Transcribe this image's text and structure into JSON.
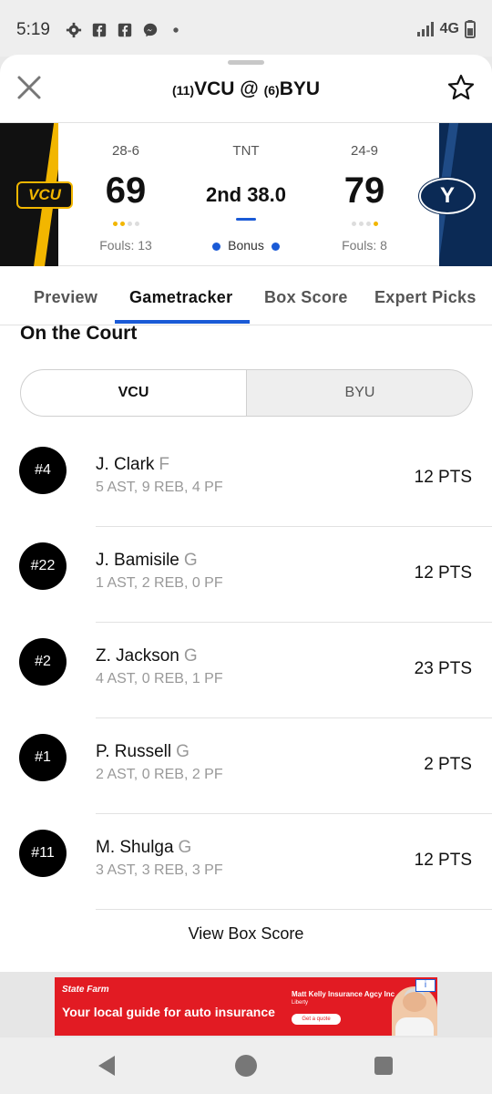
{
  "status_bar": {
    "time": "5:19",
    "network": "4G",
    "icons": [
      "gear-icon",
      "facebook-icon",
      "facebook-icon",
      "messenger-icon",
      "dot-icon",
      "signal-icon",
      "battery-icon"
    ]
  },
  "header": {
    "away_rank": "(11)",
    "away_name": "VCU",
    "separator": "@",
    "home_rank": "(6)",
    "home_name": "BYU"
  },
  "scoreboard": {
    "away": {
      "logo_text": "VCU",
      "record": "28-6",
      "score": "69",
      "fouls": "Fouls: 13",
      "timeouts_used": 2,
      "timeouts_total": 4
    },
    "home": {
      "logo_text": "Y",
      "record": "24-9",
      "score": "79",
      "fouls": "Fouls: 8",
      "timeouts_used": 1,
      "timeouts_total": 4
    },
    "network": "TNT",
    "clock": "2nd 38.0",
    "bonus": "Bonus",
    "colors": {
      "vcu_gold": "#f2b600",
      "byu_navy": "#0b2a55",
      "accent_blue": "#1a5ad6"
    }
  },
  "tabs": [
    {
      "label": "Preview",
      "active": false
    },
    {
      "label": "Gametracker",
      "active": true
    },
    {
      "label": "Box Score",
      "active": false
    },
    {
      "label": "Expert Picks",
      "active": false
    }
  ],
  "court": {
    "title": "On the Court",
    "toggle": {
      "selected": "VCU",
      "other": "BYU"
    },
    "players": [
      {
        "number": "#4",
        "name": "J. Clark",
        "pos": "F",
        "stats": "5 AST, 9 REB, 4 PF",
        "pts": "12 PTS"
      },
      {
        "number": "#22",
        "name": "J. Bamisile",
        "pos": "G",
        "stats": "1 AST, 2 REB, 0 PF",
        "pts": "12 PTS"
      },
      {
        "number": "#2",
        "name": "Z. Jackson",
        "pos": "G",
        "stats": "4 AST, 0 REB, 1 PF",
        "pts": "23 PTS"
      },
      {
        "number": "#1",
        "name": "P. Russell",
        "pos": "G",
        "stats": "2 AST, 0 REB, 2 PF",
        "pts": "2 PTS"
      },
      {
        "number": "#11",
        "name": "M. Shulga",
        "pos": "G",
        "stats": "3 AST, 3 REB, 3 PF",
        "pts": "12 PTS"
      }
    ],
    "view_box_score": "View Box Score"
  },
  "ad": {
    "brand": "State Farm",
    "headline": "Your local guide for auto insurance",
    "agent": "Matt Kelly Insurance Agcy Inc",
    "location": "Liberty",
    "cta": "Get a quote",
    "info": "i"
  }
}
